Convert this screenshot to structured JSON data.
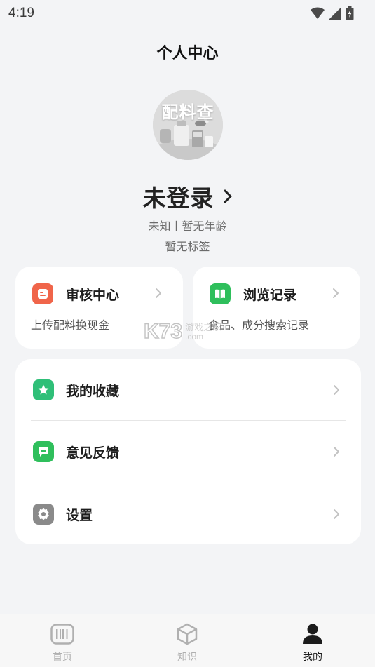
{
  "status_bar": {
    "time": "4:19"
  },
  "header": {
    "title": "个人中心"
  },
  "profile": {
    "avatar_text": "配料查",
    "name": "未登录",
    "meta": "未知丨暂无年龄",
    "tags": "暂无标签"
  },
  "quick_cards": [
    {
      "title": "审核中心",
      "subtitle": "上传配料换现金",
      "icon": "upload-icon",
      "color": "#f0654a"
    },
    {
      "title": "浏览记录",
      "subtitle": "食品、成分搜索记录",
      "icon": "book-icon",
      "color": "#2fbf5c"
    }
  ],
  "menu": [
    {
      "label": "我的收藏",
      "icon": "star-icon",
      "color": "#2fbf78"
    },
    {
      "label": "意见反馈",
      "icon": "feedback-icon",
      "color": "#2fbf5c"
    },
    {
      "label": "设置",
      "icon": "gear-icon",
      "color": "#8a8a8a"
    }
  ],
  "watermark": {
    "logo": "K73",
    "cn": "游戏之家",
    "com": ".com"
  },
  "tabs": [
    {
      "label": "首页",
      "icon": "barcode-icon",
      "active": false
    },
    {
      "label": "知识",
      "icon": "cube-icon",
      "active": false
    },
    {
      "label": "我的",
      "icon": "user-icon",
      "active": true
    }
  ]
}
